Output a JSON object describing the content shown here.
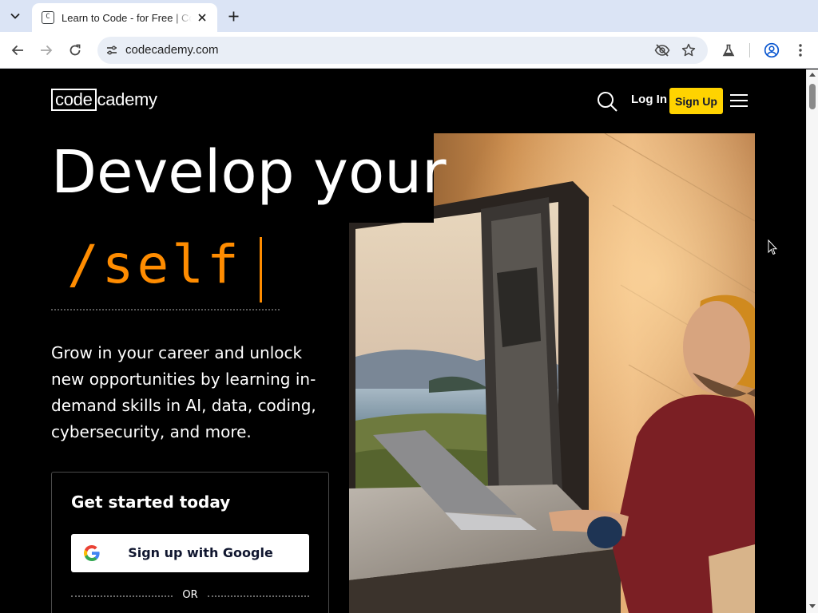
{
  "browser": {
    "tab_title": "Learn to Code - for Free | Codecademy",
    "url": "codecademy.com",
    "favicon_letter": "C"
  },
  "header": {
    "logo_box": "code",
    "logo_rest": "cademy",
    "login_label": "Log In",
    "signup_label": "Sign Up"
  },
  "hero": {
    "headline": "Develop your",
    "typed_word": "/self",
    "intro": "Grow in your career and unlock new opportunities by learning in-demand skills in AI, data, coding, cybersecurity, and more."
  },
  "signup_card": {
    "title": "Get started today",
    "google_button": "Sign up with Google",
    "divider": "OR"
  },
  "colors": {
    "accent_yellow": "#ffd300",
    "accent_orange": "#ff8c00",
    "navy": "#10162f"
  }
}
